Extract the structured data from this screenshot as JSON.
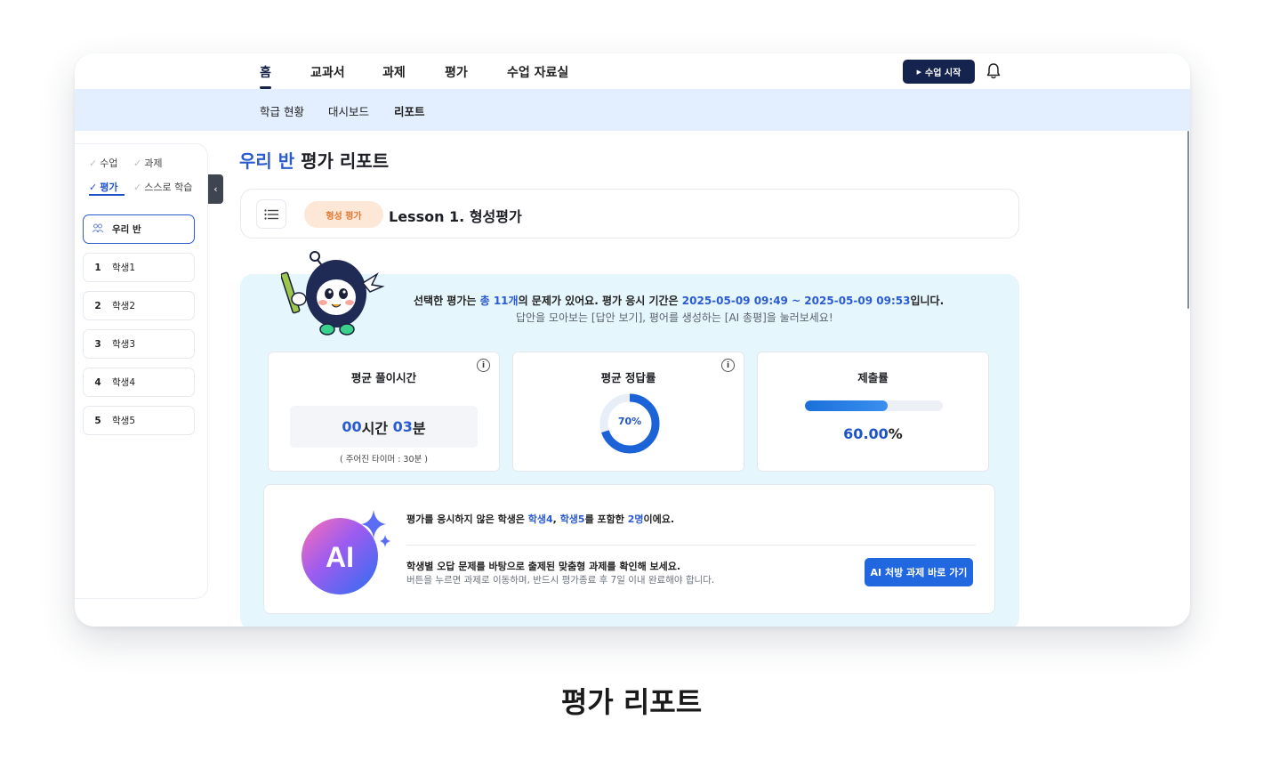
{
  "nav": {
    "tabs": [
      "홈",
      "교과서",
      "과제",
      "평가",
      "수업 자료실"
    ],
    "active_tab": "홈",
    "start_button": "수업 시작",
    "sub_tabs": [
      "학급 현황",
      "대시보드",
      "리포트"
    ],
    "active_sub_tab": "리포트"
  },
  "sidebar": {
    "filters": [
      {
        "label": "수업",
        "checked": false
      },
      {
        "label": "과제",
        "checked": false
      },
      {
        "label": "평가",
        "checked": true
      },
      {
        "label": "스스로 학습",
        "checked": false
      }
    ],
    "class_item": "우리 반",
    "students": [
      {
        "num": "1",
        "name": "학생1"
      },
      {
        "num": "2",
        "name": "학생2"
      },
      {
        "num": "3",
        "name": "학생3"
      },
      {
        "num": "4",
        "name": "학생4"
      },
      {
        "num": "5",
        "name": "학생5"
      }
    ]
  },
  "main": {
    "title_highlight": "우리 반",
    "title_rest": "평가 리포트",
    "lesson_badge": "형성 평가",
    "lesson_title": "Lesson 1. 형성평가",
    "summary": {
      "p1": "선택한 평가는 ",
      "count": "총 11개",
      "p2": "의 문제가 있어요. 평가 응시 기간은 ",
      "period": "2025-05-09 09:49 ~ 2025-05-09 09:53",
      "p3": "입니다.",
      "hint": "답안을 모아보는 [답안 보기], 평어를 생성하는 [AI 총평]을 눌러보세요!"
    },
    "cards": {
      "time": {
        "title": "평균 풀이시간",
        "hours": "00",
        "hours_unit": "시간",
        "minutes": "03",
        "minutes_unit": "분",
        "note": "( 주어진 타이머 : 30분 )"
      },
      "accuracy": {
        "title": "평균 정답률",
        "value": 70,
        "label_num": "70",
        "label_unit": "%"
      },
      "submission": {
        "title": "제출률",
        "value": 60.0,
        "label_num": "60.00",
        "label_unit": "%"
      }
    },
    "ai": {
      "logo_text": "AI",
      "l1_a": "평가를 응시하지 않은 학생은 ",
      "l1_s1": "학생4",
      "l1_sep": ", ",
      "l1_s2": "학생5",
      "l1_b": "를 포함한 ",
      "l1_cnt": "2명",
      "l1_c": "이에요.",
      "l2": "학생별 오답 문제를 바탕으로 출제된 맞춤형 과제를 확인해 보세요.",
      "l3": "버튼을 누르면 과제로 이동하며, 반드시 평가종료 후 7일 이내 완료해야 합니다.",
      "button": "AI 처방 과제 바로 가기"
    }
  },
  "caption": "평가 리포트",
  "colors": {
    "accent": "#2a5bd0",
    "navy": "#15234f",
    "panel": "#e6f6fd",
    "subnav": "#e3efff"
  }
}
